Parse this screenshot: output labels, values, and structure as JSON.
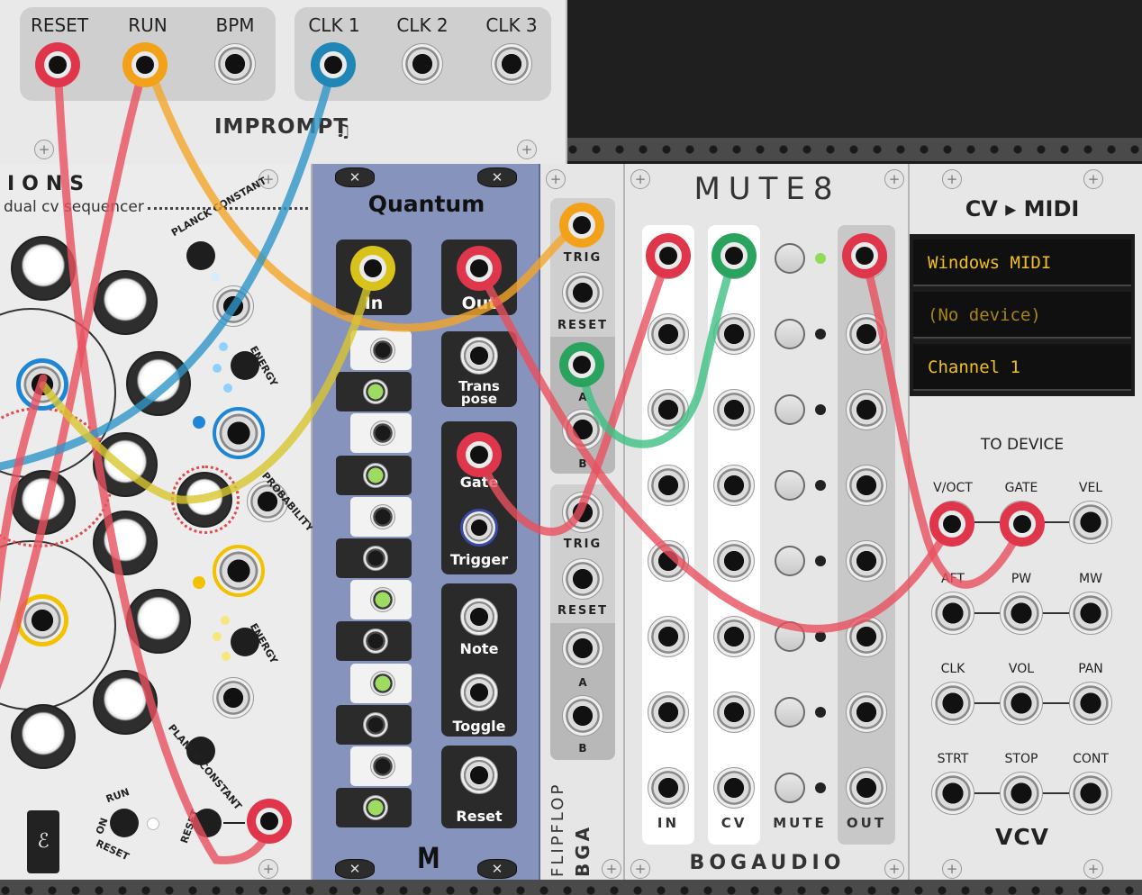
{
  "impromptu": {
    "labels": [
      "RESET",
      "RUN",
      "BPM",
      "CLK 1",
      "CLK 2",
      "CLK 3"
    ],
    "brand": "IMPROMPT"
  },
  "ions": {
    "title": "IONS",
    "subtitle": "dual cv sequencer",
    "arc_labels": {
      "planck_constant_1": "PLANCK CONSTANT",
      "energy_1": "ENERGY",
      "probability": "PROBABILITY",
      "energy_2": "ENERGY",
      "planck_constant_2": "PLANCK CONSTANT",
      "run": "RUN",
      "on": "ON",
      "reset": "RESET",
      "reset_2": "RESET"
    },
    "colors": {
      "blue": "#1f86d6",
      "yellow": "#f2c200",
      "red": "#e8364a",
      "green": "#2faa5a"
    }
  },
  "quantum": {
    "title": "Quantum",
    "in_label": "In",
    "out_label": "Out",
    "transpose_label": "Trans pose",
    "gate_label": "Gate",
    "trigger_label": "Trigger",
    "note_label": "Note",
    "toggle_label": "Toggle",
    "reset_label": "Reset",
    "logo": "M",
    "color": "#8593bd"
  },
  "flipflop": {
    "trig": "TRIG",
    "reset": "RESET",
    "a": "A",
    "b": "B",
    "trig2": "TRIG",
    "reset2": "RESET",
    "a2": "A",
    "b2": "B",
    "name": "FLIPFLOP",
    "brand": "BGA"
  },
  "mute8": {
    "title": "MUTE8",
    "col_in": "IN",
    "col_cv": "CV",
    "col_mute": "MUTE",
    "col_out": "OUT",
    "brand": "BOGAUDIO"
  },
  "cvmidi": {
    "title": "CV ▸ MIDI",
    "driver": "Windows MIDI",
    "device": "(No device)",
    "channel": "Channel 1",
    "section": "TO DEVICE",
    "jack_labels": [
      "V/OCT",
      "GATE",
      "VEL",
      "AFT",
      "PW",
      "MW",
      "CLK",
      "VOL",
      "PAN",
      "STRT",
      "STOP",
      "CONT"
    ],
    "brand": "VCV",
    "display_text_color": "#f0c020"
  },
  "cable_colors": {
    "red": "#e8505f",
    "orange": "#f2a62a",
    "blue": "#2f96c8",
    "yellow": "#d8c630",
    "green": "#3fbf83"
  }
}
